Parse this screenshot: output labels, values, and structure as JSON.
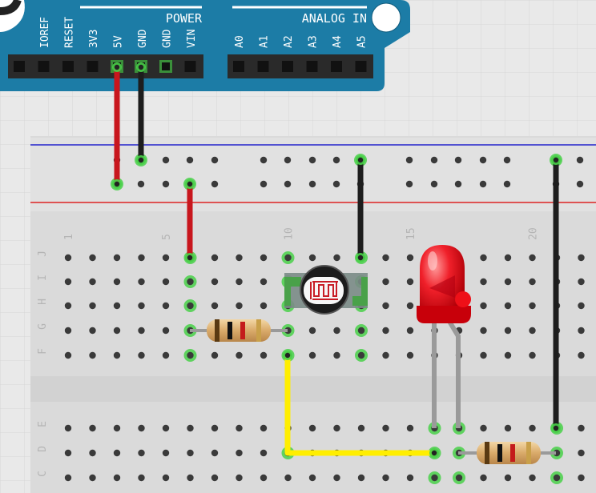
{
  "arduino": {
    "power_title": "POWER",
    "analog_title": "ANALOG IN",
    "power_pins": [
      "IOREF",
      "RESET",
      "3V3",
      "5V",
      "GND",
      "GND",
      "VIN"
    ],
    "analog_pins": [
      "A0",
      "A1",
      "A2",
      "A3",
      "A4",
      "A5"
    ]
  },
  "breadboard": {
    "column_numbers": [
      "1",
      "5",
      "10",
      "15",
      "20"
    ],
    "row_letters_top": [
      "J",
      "I",
      "H",
      "G",
      "F"
    ],
    "row_letters_bottom": [
      "E",
      "D",
      "C"
    ]
  },
  "colors": {
    "board_blue": "#1c7ca6",
    "wire_red": "#c8161d",
    "wire_black": "#1d1d1d",
    "wire_yellow": "#ffee00",
    "led_red": "#e8101a",
    "hole_highlight": "#49d049"
  },
  "components": {
    "photoresistor": "photoresistor",
    "led": "red-led",
    "resistors": [
      "resistor-1",
      "resistor-2"
    ]
  }
}
